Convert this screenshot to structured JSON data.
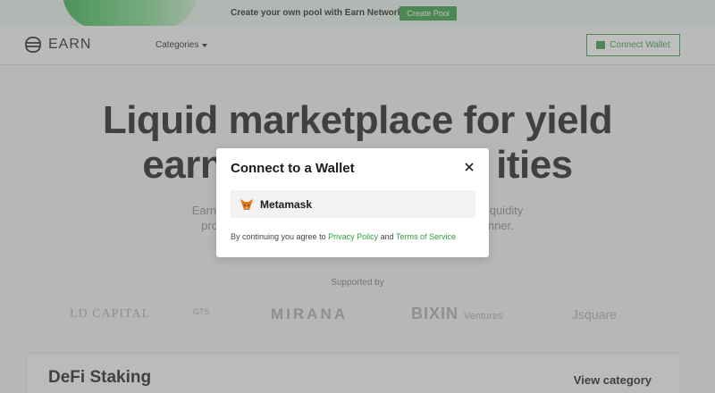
{
  "banner": {
    "text": "Create your own pool with Earn Network",
    "button_label": "Create Pool"
  },
  "nav": {
    "logo_text": "EARN",
    "categories_label": "Categories",
    "connect_wallet_label": "Connect Wallet"
  },
  "hero": {
    "line1": "Liquid marketplace for yield",
    "line2": "earn                          ities",
    "sub_line1": "Earn Netwo                                                                  ect liquidity",
    "sub_line2": "provide                                                                        manner."
  },
  "supporters": {
    "label": "Supported by",
    "partners": [
      "LD CAPITAL",
      "GTS",
      "MIRANA",
      "BIXIN",
      "Ventures",
      "Jsquare"
    ]
  },
  "card": {
    "title": "DeFi Staking",
    "link": "View category"
  },
  "modal": {
    "title": "Connect to a Wallet",
    "option_label": "Metamask",
    "terms_prefix": "By continuing you agree to ",
    "privacy_link": "Privacy Policy",
    "terms_and": " and ",
    "tos_link": "Terms of Service"
  },
  "colors": {
    "accent": "#2e9d3f",
    "overlay": "rgba(110,110,110,0.45)"
  }
}
